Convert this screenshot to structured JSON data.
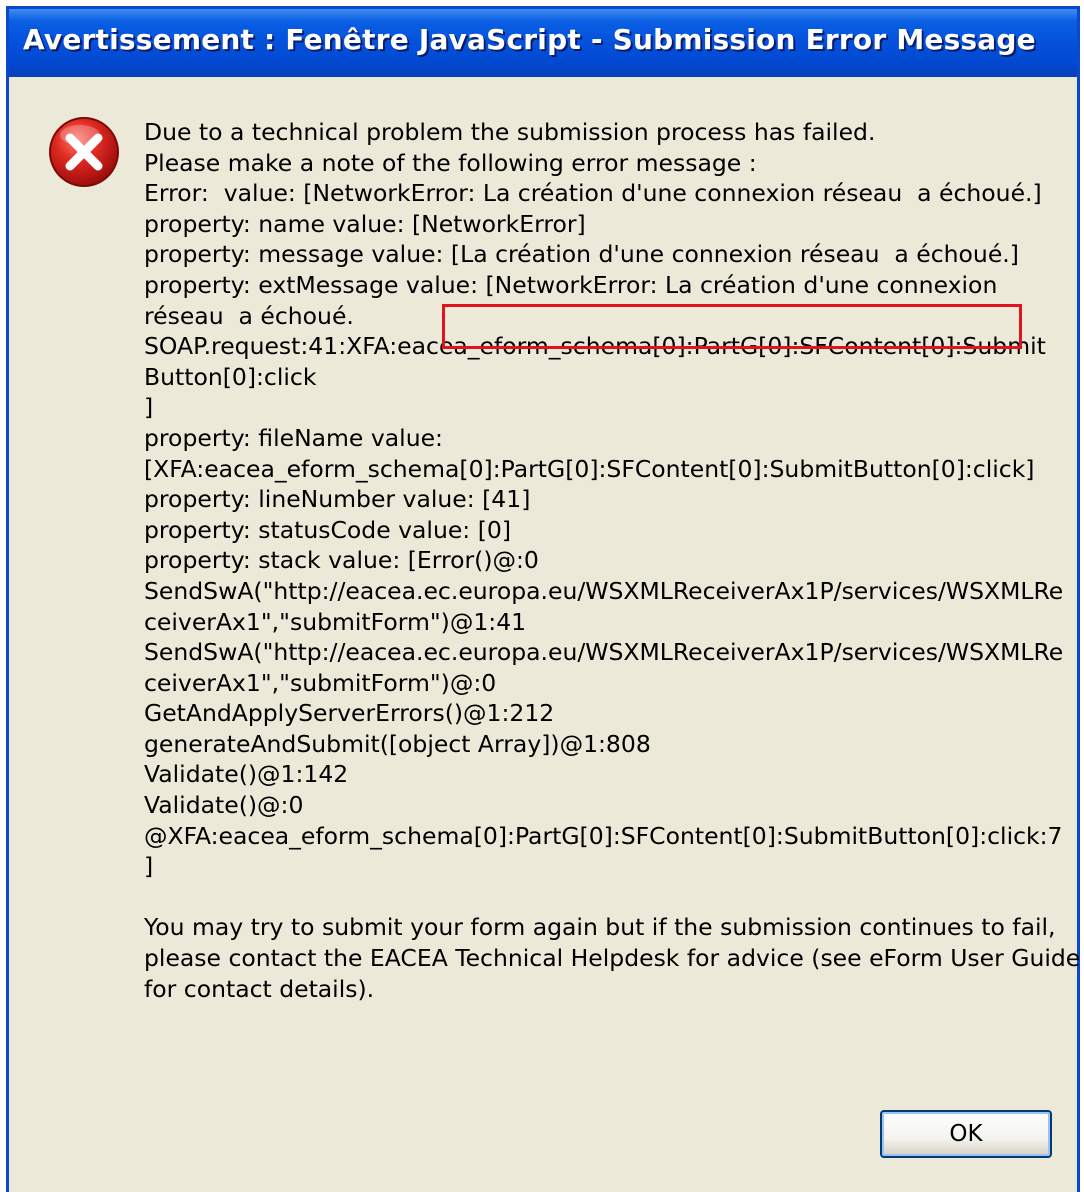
{
  "window": {
    "title": "Avertissement : Fenêtre JavaScript - Submission Error Message"
  },
  "icon": {
    "name": "error-icon",
    "color": "#d2141b"
  },
  "message": {
    "lines": [
      "Due to a technical problem the submission process has failed.",
      "Please make a note of the following error message :",
      "Error:  value: [NetworkError: La création d'une connexion réseau  a échoué.]",
      "property: name value: [NetworkError]",
      "property: message value: [La création d'une connexion réseau  a échoué.]",
      "property: extMessage value: [NetworkError: La création d'une connexion",
      "réseau  a échoué.",
      "SOAP.request:41:XFA:eacea_eform_schema[0]:PartG[0]:SFContent[0]:Submit",
      "Button[0]:click",
      "]",
      "property: fileName value:",
      "[XFA:eacea_eform_schema[0]:PartG[0]:SFContent[0]:SubmitButton[0]:click]",
      "property: lineNumber value: [41]",
      "property: statusCode value: [0]",
      "property: stack value: [Error()@:0",
      "SendSwA(\"http://eacea.ec.europa.eu/WSXMLReceiverAx1P/services/WSXMLRe",
      "ceiverAx1\",\"submitForm\")@1:41",
      "SendSwA(\"http://eacea.ec.europa.eu/WSXMLReceiverAx1P/services/WSXMLRe",
      "ceiverAx1\",\"submitForm\")@:0",
      "GetAndApplyServerErrors()@1:212",
      "generateAndSubmit([object Array])@1:808",
      "Validate()@1:142",
      "Validate()@:0",
      "@XFA:eacea_eform_schema[0]:PartG[0]:SFContent[0]:SubmitButton[0]:click:7",
      "]",
      "",
      "You may try to submit your form again but if the submission continues to fail,",
      "please contact the EACEA Technical Helpdesk for advice (see eForm User Guide",
      "for contact details)."
    ]
  },
  "highlight": {
    "color": "#e0141c"
  },
  "buttons": {
    "ok_label": "OK"
  }
}
